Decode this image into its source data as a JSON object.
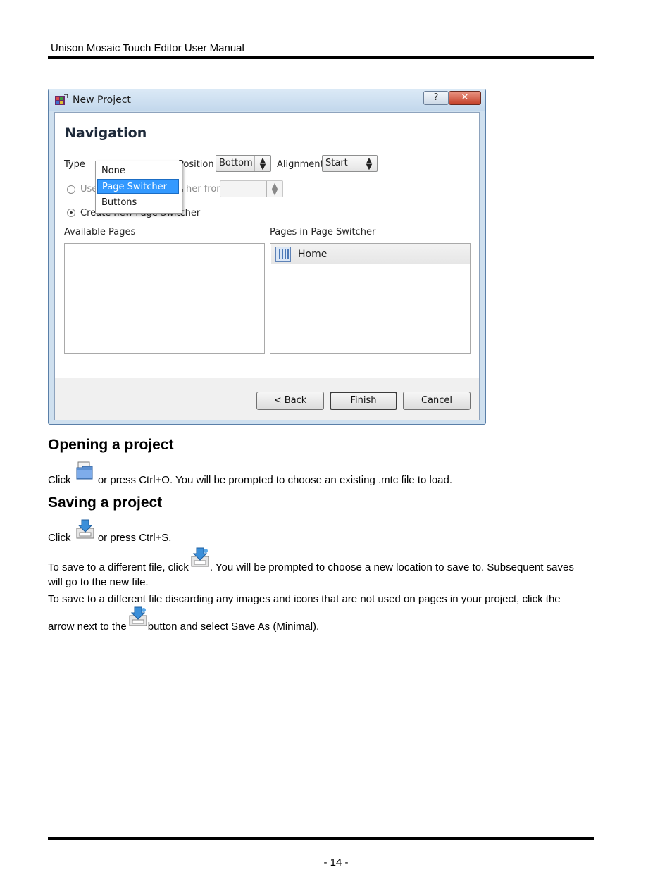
{
  "header": {
    "title": "Unison Mosaic Touch Editor User Manual"
  },
  "dialog": {
    "title": "New Project",
    "help_label": "?",
    "close_label": "✕",
    "heading": "Navigation",
    "type_label": "Type",
    "type_menu": {
      "options": [
        "None",
        "Page Switcher",
        "Buttons"
      ],
      "selected": "Page Switcher"
    },
    "position_label": "Position",
    "position_value": "Bottom",
    "alignment_label": "Alignment",
    "alignment_value": "Start",
    "use_existing_label_visible": "Use",
    "use_existing_label_tail": "her from",
    "create_new_label": "Create new Page Switcher",
    "available_pages_label": "Available Pages",
    "pages_in_switcher_label": "Pages in Page Switcher",
    "pages_in_switcher": [
      "Home"
    ],
    "back_button": "< Back",
    "finish_button": "Finish",
    "cancel_button": "Cancel"
  },
  "sections": {
    "opening": {
      "heading": "Opening a project",
      "p1_before": "Click",
      "p1_after": "or press Ctrl+O. You will be prompted to choose an existing .mtc file to load."
    },
    "saving": {
      "heading": "Saving a project",
      "p1_before": "Click",
      "p1_after": "or press Ctrl+S.",
      "p2_before": "To save to a different file, click",
      "p2_after": ". You will be prompted to choose a new location to save to. Subsequent saves",
      "p2_line2": "will go to the new file.",
      "p3_line1": "To save to a different file discarding any images and icons that are not used on pages in your project, click the",
      "p3_before": "arrow next to the",
      "p3_after": "button and select Save As (Minimal)."
    }
  },
  "footer": {
    "page_number": "- 14 -"
  },
  "icons": {
    "open": "folder-open-icon",
    "save": "save-icon",
    "save_as": "save-as-icon"
  }
}
